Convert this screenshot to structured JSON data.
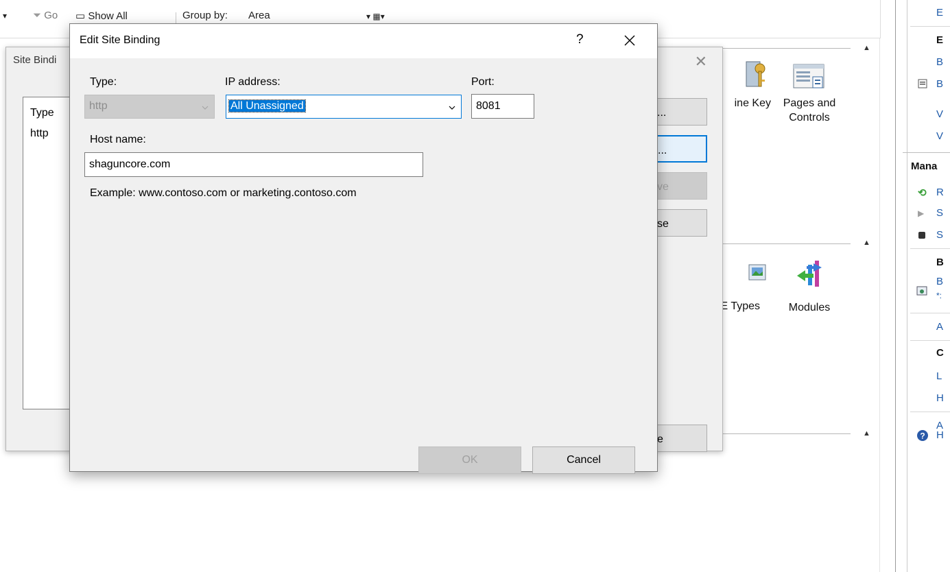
{
  "toolbar": {
    "go_label": "Go",
    "show_all_label": "Show All",
    "group_by_label": "Group by:",
    "group_by_value": "Area"
  },
  "features": [
    {
      "label": "Machine Key",
      "visible_label": "ine Key",
      "icon": "machine-key-icon"
    },
    {
      "label": "Pages and Controls",
      "line1": "Pages and",
      "line2": "Controls",
      "icon": "pages-controls-icon"
    },
    {
      "label": "MIME Types",
      "visible_label": "E Types",
      "icon": "mime-types-icon"
    },
    {
      "label": "Modules",
      "visible_label": "Modules",
      "icon": "modules-icon"
    }
  ],
  "actions_pane": {
    "items": [
      {
        "text": "E",
        "kind": "link"
      },
      {
        "text": "E",
        "kind": "heading"
      },
      {
        "text": "B",
        "kind": "link"
      },
      {
        "text": "B",
        "kind": "link",
        "icon": "document-icon"
      },
      {
        "text": "V",
        "kind": "link"
      },
      {
        "text": "V",
        "kind": "link"
      },
      {
        "text": "Mana",
        "kind": "section"
      },
      {
        "text": "R",
        "kind": "link",
        "icon": "restart-icon"
      },
      {
        "text": "S",
        "kind": "link",
        "icon": "start-icon"
      },
      {
        "text": "S",
        "kind": "link",
        "icon": "stop-icon"
      },
      {
        "text": "B",
        "kind": "heading"
      },
      {
        "text": "B",
        "kind": "link",
        "icon": "browse-icon",
        "sub": "*:"
      },
      {
        "text": "A",
        "kind": "link"
      },
      {
        "text": "C",
        "kind": "heading"
      },
      {
        "text": "L",
        "kind": "link"
      },
      {
        "text": "H",
        "kind": "link"
      },
      {
        "text": "A",
        "kind": "link"
      },
      {
        "text": "H",
        "kind": "link",
        "icon": "help-icon"
      }
    ]
  },
  "site_bindings": {
    "title": "Site Bindi",
    "columns": [
      "Type"
    ],
    "rows": [
      [
        "http"
      ]
    ],
    "buttons": [
      {
        "label": "...",
        "state": "normal"
      },
      {
        "label": "...",
        "state": "focused"
      },
      {
        "label": "ve",
        "state": "disabled"
      },
      {
        "label": "se",
        "state": "normal"
      },
      {
        "label": "e",
        "state": "normal"
      }
    ]
  },
  "edit_dialog": {
    "title": "Edit Site Binding",
    "help_label": "?",
    "type_label": "Type:",
    "type_value": "http",
    "ip_label": "IP address:",
    "ip_value": "All Unassigned",
    "port_label": "Port:",
    "port_value": "8081",
    "host_label": "Host name:",
    "host_value": "shaguncore.com",
    "example_text": "Example: www.contoso.com or marketing.contoso.com",
    "ok_label": "OK",
    "cancel_label": "Cancel"
  },
  "colors": {
    "accent": "#0078d7",
    "link": "#1e5aa8",
    "dialog_bg": "#f0f0f0",
    "disabled_bg": "#cccccc"
  }
}
